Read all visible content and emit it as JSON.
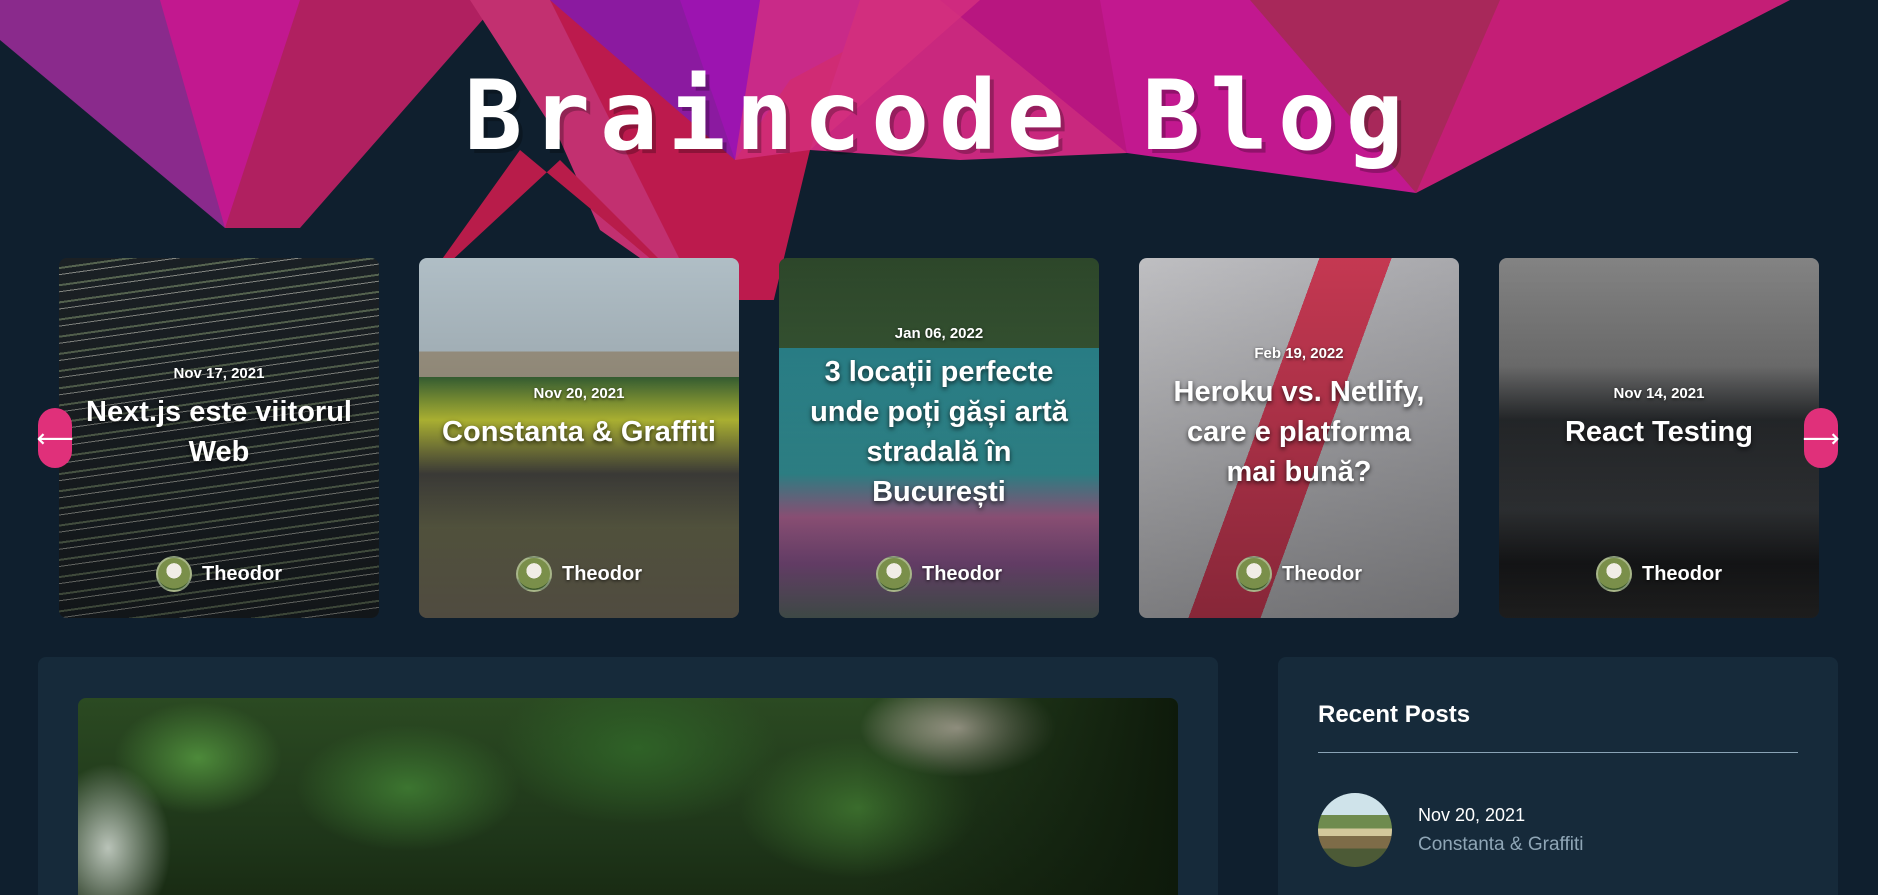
{
  "header": {
    "title": "Braincode Blog"
  },
  "carousel": {
    "prev_icon": "arrow-left-icon",
    "next_icon": "arrow-right-icon",
    "prev_glyph": "⟵",
    "next_glyph": "⟶",
    "cards": [
      {
        "date": "Nov 17, 2021",
        "title": "Next.js este viitorul Web",
        "author": "Theodor"
      },
      {
        "date": "Nov 20, 2021",
        "title": "Constanta & Graffiti",
        "author": "Theodor"
      },
      {
        "date": "Jan 06, 2022",
        "title": "3 locații perfecte unde poți găși artă stradală în București",
        "author": "Theodor"
      },
      {
        "date": "Feb 19, 2022",
        "title": "Heroku vs. Netlify, care e platforma mai bună?",
        "author": "Theodor"
      },
      {
        "date": "Nov 14, 2021",
        "title": "React Testing",
        "author": "Theodor"
      }
    ]
  },
  "sidebar": {
    "title": "Recent Posts",
    "recent": [
      {
        "date": "Nov 20, 2021",
        "title": "Constanta & Graffiti"
      }
    ]
  },
  "colors": {
    "background": "#0f1f2e",
    "panel": "#162a3a",
    "accent": "#e0307a",
    "muted_text": "#8fa6b6"
  }
}
